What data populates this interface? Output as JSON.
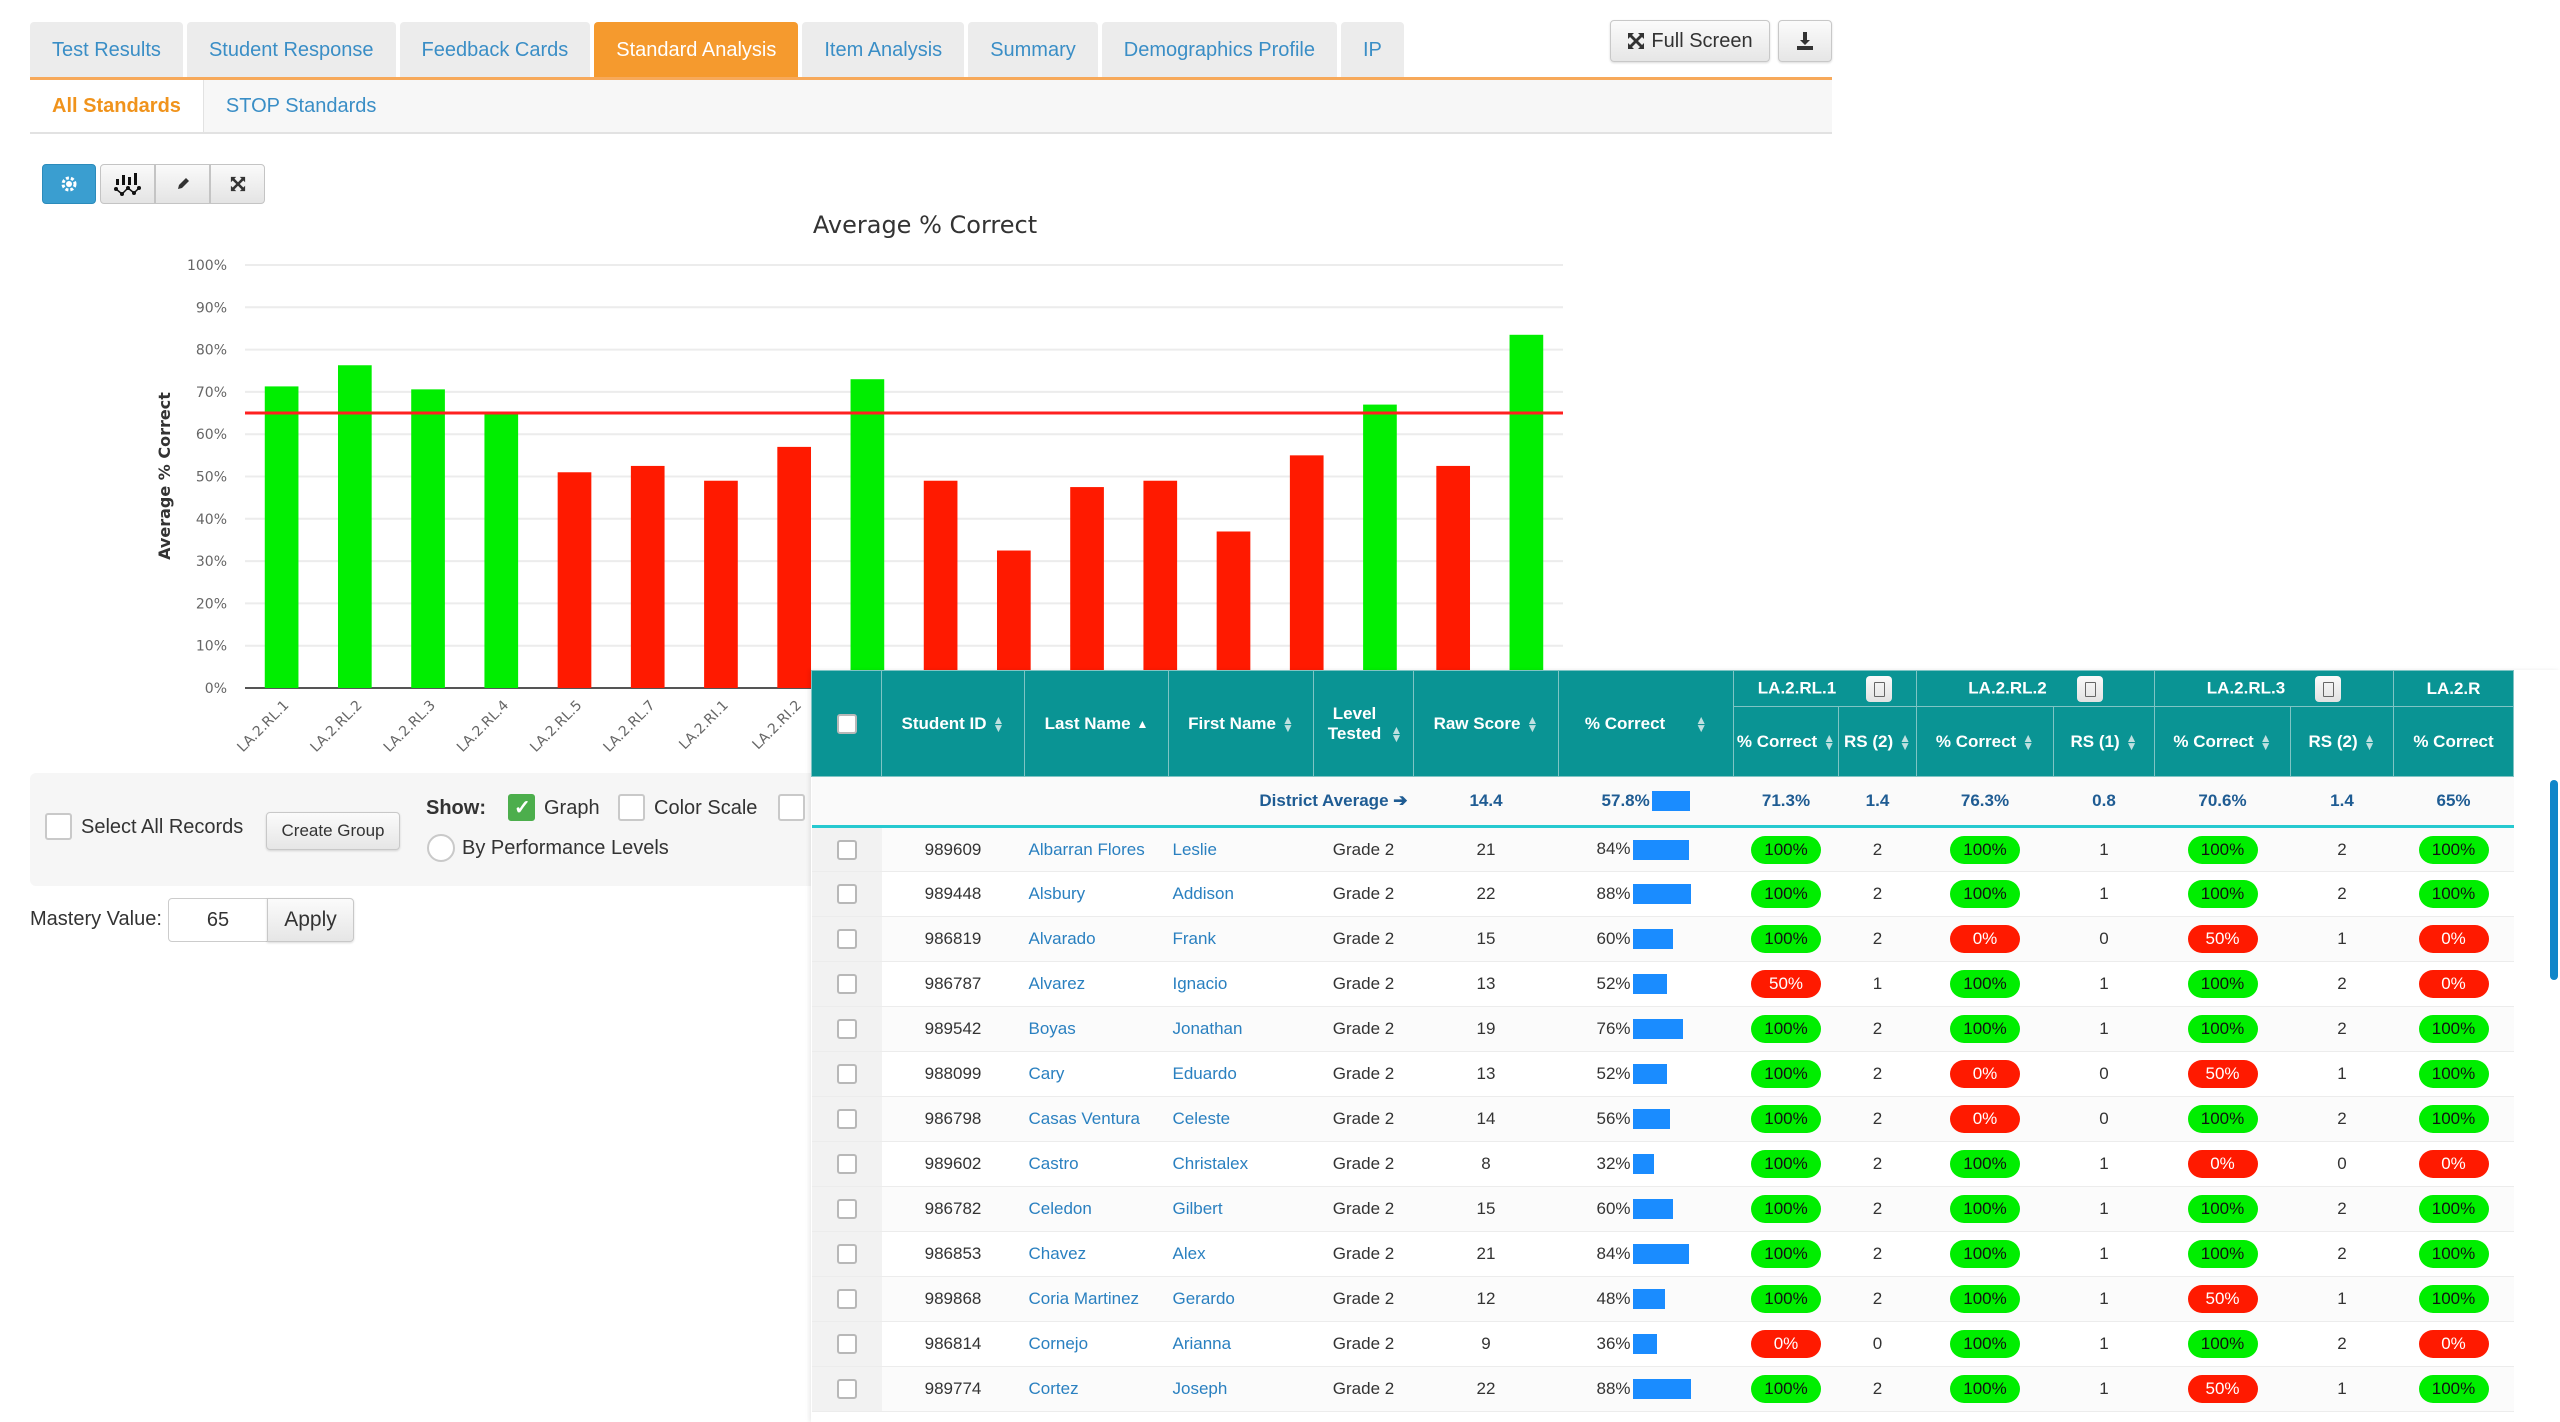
{
  "tabs": [
    {
      "label": "Test Results",
      "active": false
    },
    {
      "label": "Student Response",
      "active": false
    },
    {
      "label": "Feedback Cards",
      "active": false
    },
    {
      "label": "Standard Analysis",
      "active": true
    },
    {
      "label": "Item Analysis",
      "active": false
    },
    {
      "label": "Summary",
      "active": false
    },
    {
      "label": "Demographics Profile",
      "active": false
    },
    {
      "label": "IP",
      "active": false
    }
  ],
  "subtabs": [
    {
      "label": "All Standards",
      "active": true
    },
    {
      "label": "STOP Standards",
      "active": false
    }
  ],
  "toolbar": {
    "fullscreen_label": "Full Screen",
    "fullscreen_icon": "expand-arrows-icon",
    "download_icon": "download-icon"
  },
  "chart_toolbar": [
    {
      "icon": "gear-icon"
    },
    {
      "icon": "chart-type-icon"
    },
    {
      "icon": "pencil-icon"
    },
    {
      "icon": "expand-icon"
    }
  ],
  "chart_data": {
    "type": "bar",
    "title": "Average % Correct",
    "xlabel": "",
    "ylabel": "Average % Correct",
    "ylim": [
      0,
      100
    ],
    "yticks": [
      "0%",
      "10%",
      "20%",
      "30%",
      "40%",
      "50%",
      "60%",
      "70%",
      "80%",
      "90%",
      "100%"
    ],
    "grid": true,
    "mastery_line": 65,
    "categories": [
      "LA.2.RL.1",
      "LA.2.RL.2",
      "LA.2.RL.3",
      "LA.2.RL.4",
      "LA.2.RL.5",
      "LA.2.RL.7",
      "LA.2.RI.1",
      "LA.2.RI.2",
      "",
      "",
      "",
      "",
      "",
      "",
      "",
      "",
      "",
      ""
    ],
    "values": [
      71.3,
      76.3,
      70.6,
      65,
      51,
      52.5,
      49,
      57,
      73,
      49,
      32.5,
      47.5,
      49,
      37,
      55,
      67,
      52.5,
      83.5
    ],
    "colors": {
      "above": "#00ee00",
      "below": "#ff1a00",
      "line": "#ff2020"
    }
  },
  "controls": {
    "select_all_label": "Select All Records",
    "create_group_label": "Create Group",
    "show_label": "Show:",
    "graph_label": "Graph",
    "graph_checked": true,
    "color_scale_label": "Color Scale",
    "color_scale_checked": false,
    "perf_levels_label": "By Performance Levels",
    "mastery_label": "Mastery Value:",
    "mastery_value": "65",
    "apply_label": "Apply"
  },
  "table": {
    "headers": {
      "student_id": "Student ID",
      "last_name": "Last Name",
      "first_name": "First Name",
      "level_tested": "Level Tested",
      "raw_score": "Raw Score",
      "pct_correct": "% Correct"
    },
    "standards": [
      {
        "name": "LA.2.RL.1",
        "sub": [
          "% Correct",
          "RS (2)"
        ]
      },
      {
        "name": "LA.2.RL.2",
        "sub": [
          "% Correct",
          "RS (1)"
        ]
      },
      {
        "name": "LA.2.RL.3",
        "sub": [
          "% Correct",
          "RS (2)"
        ]
      },
      {
        "name": "LA.2.R",
        "sub": [
          "% Correct"
        ]
      }
    ],
    "district_average": {
      "label": "District Average ➔",
      "raw_score": "14.4",
      "pct_correct": "57.8%",
      "pct_value": 57.8,
      "std": [
        "71.3%",
        "1.4",
        "76.3%",
        "0.8",
        "70.6%",
        "1.4",
        "65%"
      ]
    },
    "rows": [
      {
        "id": "989609",
        "last": "Albarran Flores",
        "first": "Leslie",
        "level": "Grade 2",
        "raw": "21",
        "pct": "84%",
        "pv": 84,
        "std": [
          [
            "100%",
            "pass"
          ],
          [
            "2"
          ],
          [
            "100%",
            "pass"
          ],
          [
            "1"
          ],
          [
            "100%",
            "pass"
          ],
          [
            "2"
          ],
          [
            "100%",
            "pass"
          ]
        ]
      },
      {
        "id": "989448",
        "last": "Alsbury",
        "first": "Addison",
        "level": "Grade 2",
        "raw": "22",
        "pct": "88%",
        "pv": 88,
        "std": [
          [
            "100%",
            "pass"
          ],
          [
            "2"
          ],
          [
            "100%",
            "pass"
          ],
          [
            "1"
          ],
          [
            "100%",
            "pass"
          ],
          [
            "2"
          ],
          [
            "100%",
            "pass"
          ]
        ]
      },
      {
        "id": "986819",
        "last": "Alvarado",
        "first": "Frank",
        "level": "Grade 2",
        "raw": "15",
        "pct": "60%",
        "pv": 60,
        "std": [
          [
            "100%",
            "pass"
          ],
          [
            "2"
          ],
          [
            "0%",
            "fail"
          ],
          [
            "0"
          ],
          [
            "50%",
            "fail"
          ],
          [
            "1"
          ],
          [
            "0%",
            "fail"
          ]
        ]
      },
      {
        "id": "986787",
        "last": "Alvarez",
        "first": "Ignacio",
        "level": "Grade 2",
        "raw": "13",
        "pct": "52%",
        "pv": 52,
        "std": [
          [
            "50%",
            "fail"
          ],
          [
            "1"
          ],
          [
            "100%",
            "pass"
          ],
          [
            "1"
          ],
          [
            "100%",
            "pass"
          ],
          [
            "2"
          ],
          [
            "0%",
            "fail"
          ]
        ]
      },
      {
        "id": "989542",
        "last": "Boyas",
        "first": "Jonathan",
        "level": "Grade 2",
        "raw": "19",
        "pct": "76%",
        "pv": 76,
        "std": [
          [
            "100%",
            "pass"
          ],
          [
            "2"
          ],
          [
            "100%",
            "pass"
          ],
          [
            "1"
          ],
          [
            "100%",
            "pass"
          ],
          [
            "2"
          ],
          [
            "100%",
            "pass"
          ]
        ]
      },
      {
        "id": "988099",
        "last": "Cary",
        "first": "Eduardo",
        "level": "Grade 2",
        "raw": "13",
        "pct": "52%",
        "pv": 52,
        "std": [
          [
            "100%",
            "pass"
          ],
          [
            "2"
          ],
          [
            "0%",
            "fail"
          ],
          [
            "0"
          ],
          [
            "50%",
            "fail"
          ],
          [
            "1"
          ],
          [
            "100%",
            "pass"
          ]
        ]
      },
      {
        "id": "986798",
        "last": "Casas Ventura",
        "first": "Celeste",
        "level": "Grade 2",
        "raw": "14",
        "pct": "56%",
        "pv": 56,
        "std": [
          [
            "100%",
            "pass"
          ],
          [
            "2"
          ],
          [
            "0%",
            "fail"
          ],
          [
            "0"
          ],
          [
            "100%",
            "pass"
          ],
          [
            "2"
          ],
          [
            "100%",
            "pass"
          ]
        ]
      },
      {
        "id": "989602",
        "last": "Castro",
        "first": "Christalex",
        "level": "Grade 2",
        "raw": "8",
        "pct": "32%",
        "pv": 32,
        "std": [
          [
            "100%",
            "pass"
          ],
          [
            "2"
          ],
          [
            "100%",
            "pass"
          ],
          [
            "1"
          ],
          [
            "0%",
            "fail"
          ],
          [
            "0"
          ],
          [
            "0%",
            "fail"
          ]
        ]
      },
      {
        "id": "986782",
        "last": "Celedon",
        "first": "Gilbert",
        "level": "Grade 2",
        "raw": "15",
        "pct": "60%",
        "pv": 60,
        "std": [
          [
            "100%",
            "pass"
          ],
          [
            "2"
          ],
          [
            "100%",
            "pass"
          ],
          [
            "1"
          ],
          [
            "100%",
            "pass"
          ],
          [
            "2"
          ],
          [
            "100%",
            "pass"
          ]
        ]
      },
      {
        "id": "986853",
        "last": "Chavez",
        "first": "Alex",
        "level": "Grade 2",
        "raw": "21",
        "pct": "84%",
        "pv": 84,
        "std": [
          [
            "100%",
            "pass"
          ],
          [
            "2"
          ],
          [
            "100%",
            "pass"
          ],
          [
            "1"
          ],
          [
            "100%",
            "pass"
          ],
          [
            "2"
          ],
          [
            "100%",
            "pass"
          ]
        ]
      },
      {
        "id": "989868",
        "last": "Coria Martinez",
        "first": "Gerardo",
        "level": "Grade 2",
        "raw": "12",
        "pct": "48%",
        "pv": 48,
        "std": [
          [
            "100%",
            "pass"
          ],
          [
            "2"
          ],
          [
            "100%",
            "pass"
          ],
          [
            "1"
          ],
          [
            "50%",
            "fail"
          ],
          [
            "1"
          ],
          [
            "100%",
            "pass"
          ]
        ]
      },
      {
        "id": "986814",
        "last": "Cornejo",
        "first": "Arianna",
        "level": "Grade 2",
        "raw": "9",
        "pct": "36%",
        "pv": 36,
        "std": [
          [
            "0%",
            "fail"
          ],
          [
            "0"
          ],
          [
            "100%",
            "pass"
          ],
          [
            "1"
          ],
          [
            "100%",
            "pass"
          ],
          [
            "2"
          ],
          [
            "0%",
            "fail"
          ]
        ]
      },
      {
        "id": "989774",
        "last": "Cortez",
        "first": "Joseph",
        "level": "Grade 2",
        "raw": "22",
        "pct": "88%",
        "pv": 88,
        "std": [
          [
            "100%",
            "pass"
          ],
          [
            "2"
          ],
          [
            "100%",
            "pass"
          ],
          [
            "1"
          ],
          [
            "50%",
            "fail"
          ],
          [
            "1"
          ],
          [
            "100%",
            "pass"
          ]
        ]
      }
    ]
  }
}
